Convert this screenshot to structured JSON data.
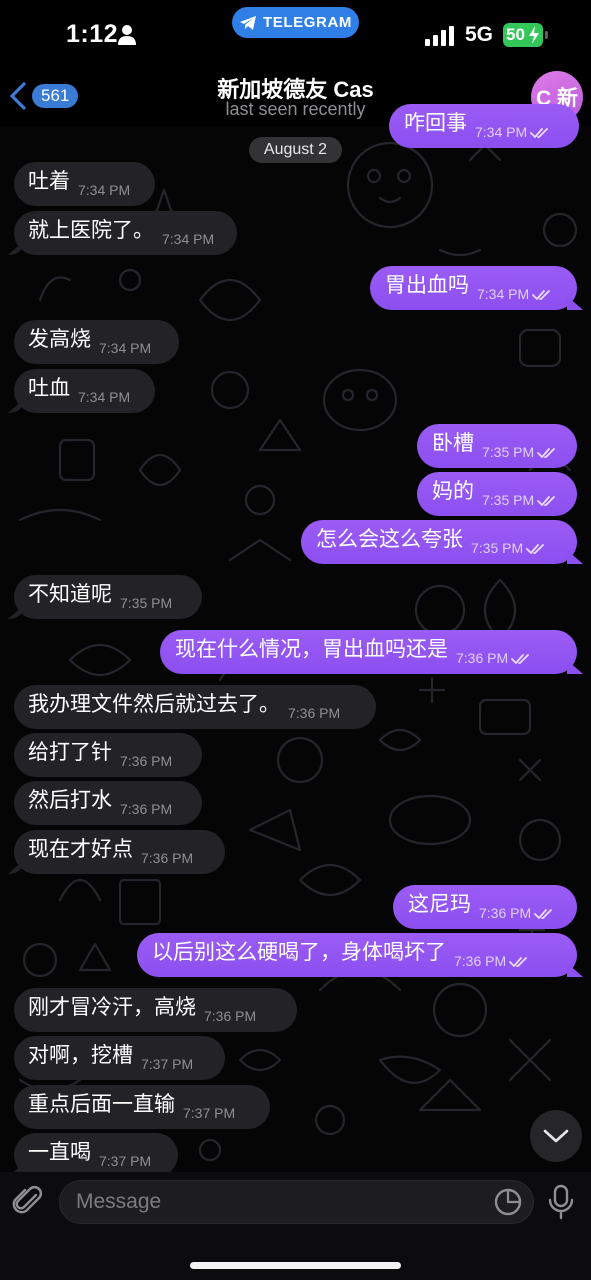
{
  "status_bar": {
    "time": "1:12",
    "telegram_label": "TELEGRAM",
    "network": "5G",
    "battery": "50"
  },
  "header": {
    "back_count": "561",
    "title": "新加坡德友 Cas",
    "subtitle": "last seen recently",
    "avatar_text": "C 新"
  },
  "date_separator": "August 2",
  "messages": [
    {
      "direction": "out",
      "text": "咋回事",
      "time": "7:34 PM",
      "read": true
    },
    {
      "direction": "in",
      "text": "吐着",
      "time": "7:34 PM"
    },
    {
      "direction": "in",
      "text": "就上医院了。",
      "time": "7:34 PM"
    },
    {
      "direction": "out",
      "text": "胃出血吗",
      "time": "7:34 PM",
      "read": true
    },
    {
      "direction": "in",
      "text": "发高烧",
      "time": "7:34 PM"
    },
    {
      "direction": "in",
      "text": "吐血",
      "time": "7:34 PM"
    },
    {
      "direction": "out",
      "text": "卧槽",
      "time": "7:35 PM",
      "read": true
    },
    {
      "direction": "out",
      "text": "妈的",
      "time": "7:35 PM",
      "read": true
    },
    {
      "direction": "out",
      "text": "怎么会这么夸张",
      "time": "7:35 PM",
      "read": true
    },
    {
      "direction": "in",
      "text": "不知道呢",
      "time": "7:35 PM"
    },
    {
      "direction": "out",
      "text": "现在什么情况，胃出血吗还是",
      "time": "7:36 PM",
      "read": true
    },
    {
      "direction": "in",
      "text": "我办理文件然后就过去了。",
      "time": "7:36 PM"
    },
    {
      "direction": "in",
      "text": "给打了针",
      "time": "7:36 PM"
    },
    {
      "direction": "in",
      "text": "然后打水",
      "time": "7:36 PM"
    },
    {
      "direction": "in",
      "text": "现在才好点",
      "time": "7:36 PM"
    },
    {
      "direction": "out",
      "text": "这尼玛",
      "time": "7:36 PM",
      "read": true
    },
    {
      "direction": "out",
      "text": "以后别这么硬喝了，身体喝坏了",
      "time": "7:36 PM",
      "read": true
    },
    {
      "direction": "in",
      "text": "刚才冒冷汗，高烧",
      "time": "7:36 PM"
    },
    {
      "direction": "in",
      "text": "对啊，挖槽",
      "time": "7:37 PM"
    },
    {
      "direction": "in",
      "text": "重点后面一直输",
      "time": "7:37 PM"
    },
    {
      "direction": "in",
      "text": "一直喝",
      "time": "7:37 PM"
    }
  ],
  "input": {
    "placeholder": "Message"
  },
  "colors": {
    "outgoing_bubble": "#9157f3",
    "incoming_bubble": "#232226",
    "accent": "#3a7bd5",
    "background": "#050506"
  },
  "icons": [
    "person-icon",
    "telegram-icon",
    "signal-icon",
    "battery-icon",
    "back-chevron-icon",
    "double-check-icon",
    "chevron-down-icon",
    "paperclip-icon",
    "sticker-icon",
    "microphone-icon"
  ]
}
